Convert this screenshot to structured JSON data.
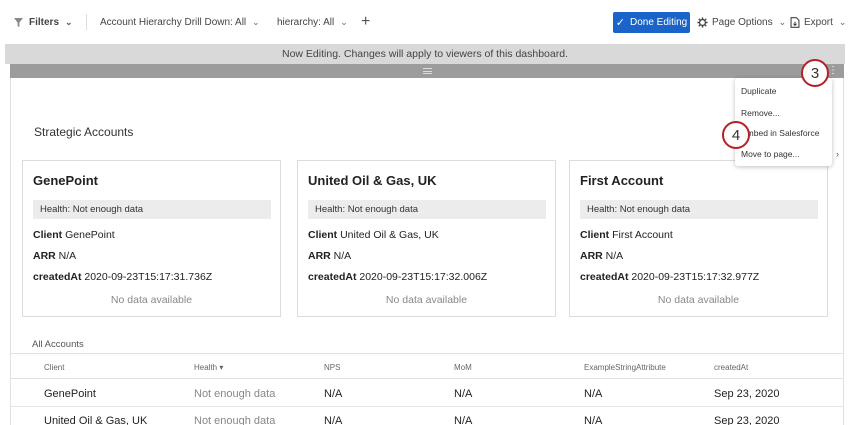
{
  "toolbar": {
    "filters_label": "Filters",
    "filter1_label": "Account Hierarchy Drill Down: All",
    "filter2_label": "hierarchy: All",
    "add_label": "+",
    "done_label": "Done Editing",
    "page_options_label": "Page Options",
    "export_label": "Export"
  },
  "banner": {
    "text": "Now Editing. Changes will apply to viewers of this dashboard."
  },
  "widget": {
    "title": "Strategic Accounts",
    "field_client": "Client",
    "field_arr": "ARR",
    "field_created": "createdAt",
    "cards": [
      {
        "name": "GenePoint",
        "health": "Health: Not enough data",
        "client": "GenePoint",
        "arr": "N/A",
        "created": "2020-09-23T15:17:31.736Z",
        "nodata": "No data available"
      },
      {
        "name": "United Oil & Gas, UK",
        "health": "Health: Not enough data",
        "client": "United Oil & Gas, UK",
        "arr": "N/A",
        "created": "2020-09-23T15:17:32.006Z",
        "nodata": "No data available"
      },
      {
        "name": "First Account",
        "health": "Health: Not enough data",
        "client": "First Account",
        "arr": "N/A",
        "created": "2020-09-23T15:17:32.977Z",
        "nodata": "No data available"
      }
    ]
  },
  "table": {
    "title": "All Accounts",
    "columns": [
      "Client",
      "Health",
      "NPS",
      "MoM",
      "ExampleStringAttribute",
      "createdAt"
    ],
    "sort_indicator": "▾",
    "rows": [
      [
        "GenePoint",
        "Not enough data",
        "N/A",
        "N/A",
        "N/A",
        "Sep 23, 2020"
      ],
      [
        "United Oil & Gas, UK",
        "Not enough data",
        "N/A",
        "N/A",
        "N/A",
        "Sep 23, 2020"
      ]
    ]
  },
  "menu": {
    "items": [
      "Duplicate",
      "Remove...",
      "Embed in Salesforce",
      "Move to page..."
    ],
    "submenu_arrow": "›"
  },
  "badges": {
    "step3": "3",
    "step4": "4"
  },
  "colors": {
    "primary_button": "#1a63c9",
    "badge_ring": "#b3222a",
    "banner_bg": "#d9d9d9",
    "drag_bar": "#9c9c9c"
  }
}
